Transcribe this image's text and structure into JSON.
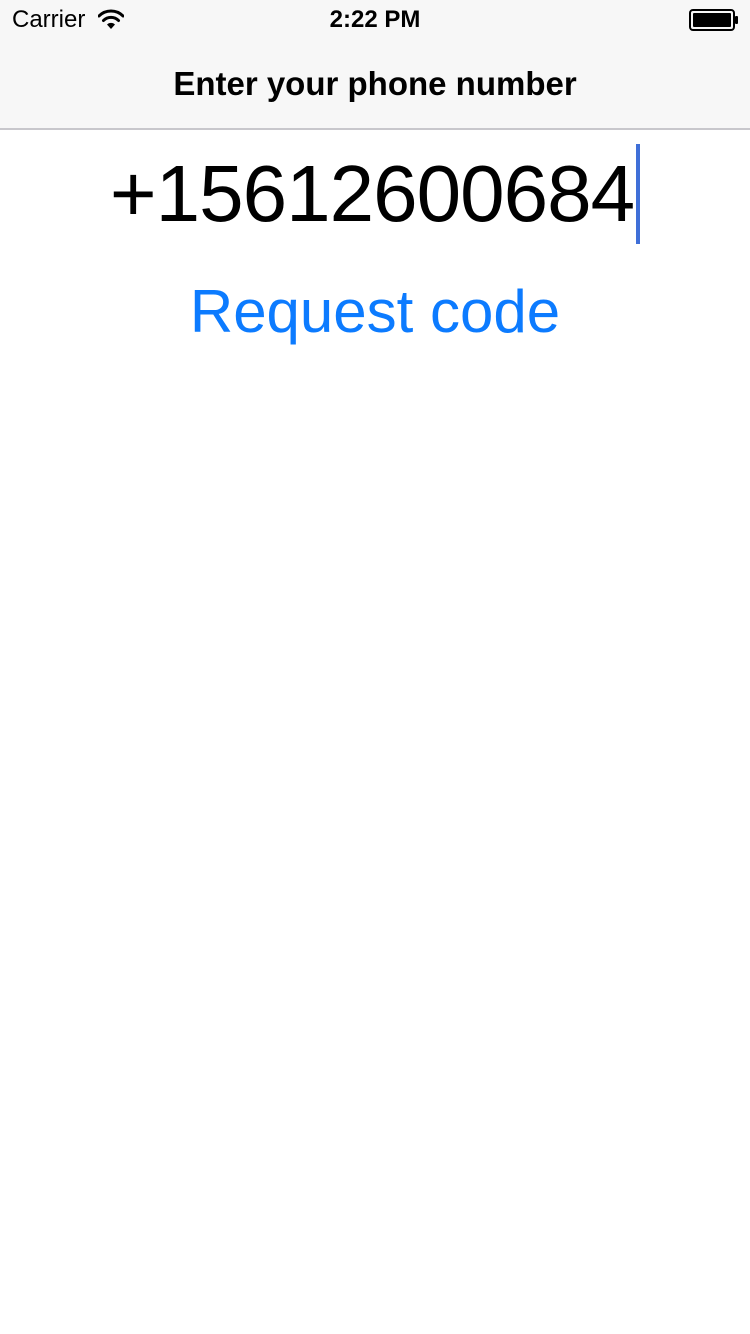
{
  "status_bar": {
    "carrier": "Carrier",
    "time": "2:22 PM",
    "wifi_icon": "wifi-icon",
    "battery_icon": "battery-icon"
  },
  "nav_bar": {
    "title": "Enter your phone number"
  },
  "phone_input": {
    "value": "+15612600684",
    "cursor_color": "#3f6fd8"
  },
  "actions": {
    "request_code_label": "Request code",
    "accent_color": "#0c7bff"
  }
}
